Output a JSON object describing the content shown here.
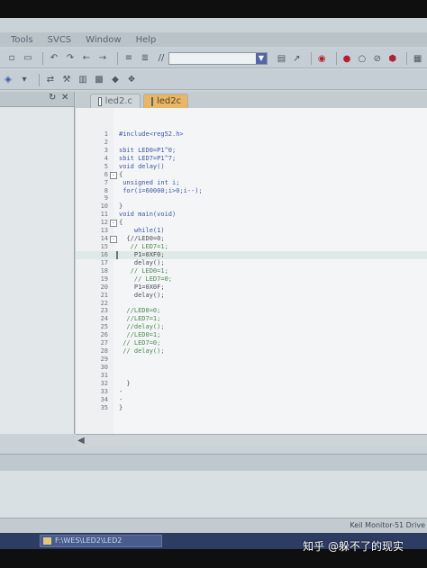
{
  "menu": {
    "items": [
      "Tools",
      "SVCS",
      "Window",
      "Help"
    ]
  },
  "left_pane": {
    "pin_icon": "pin-icon",
    "close_icon": "close-icon"
  },
  "tabs": [
    {
      "label": "led2.c",
      "active": false
    },
    {
      "label": "led2c",
      "active": true
    }
  ],
  "editor": {
    "lines": [
      {
        "n": "1",
        "text": "#include<reg52.h>"
      },
      {
        "n": "2",
        "text": ""
      },
      {
        "n": "3",
        "text": "sbit LED0=P1^0;"
      },
      {
        "n": "4",
        "text": "sbit LED7=P1^7;"
      },
      {
        "n": "5",
        "text": "void delay()"
      },
      {
        "n": "6",
        "text": "{",
        "fold": "-"
      },
      {
        "n": "7",
        "text": " unsigned int i;"
      },
      {
        "n": "8",
        "text": " for(i=60000;i>0;i--);"
      },
      {
        "n": "9",
        "text": ""
      },
      {
        "n": "10",
        "text": "}"
      },
      {
        "n": "11",
        "text": "void main(void)"
      },
      {
        "n": "12",
        "text": "{",
        "fold": "-"
      },
      {
        "n": "13",
        "text": "    while(1)"
      },
      {
        "n": "14",
        "text": "  {//LED0=0;",
        "fold": "-"
      },
      {
        "n": "15",
        "text": "   // LED7=1;"
      },
      {
        "n": "16",
        "text": "    P1=0XF0;",
        "highlight": true
      },
      {
        "n": "17",
        "text": "    delay();"
      },
      {
        "n": "18",
        "text": "   // LED0=1;"
      },
      {
        "n": "19",
        "text": "    // LED7=0;"
      },
      {
        "n": "20",
        "text": "    P1=0X0F;"
      },
      {
        "n": "21",
        "text": "    delay();"
      },
      {
        "n": "22",
        "text": ""
      },
      {
        "n": "23",
        "text": "  //LED0=0;"
      },
      {
        "n": "24",
        "text": "  //LED7=1;"
      },
      {
        "n": "25",
        "text": "  //delay();"
      },
      {
        "n": "26",
        "text": "  //LED0=1;"
      },
      {
        "n": "27",
        "text": " // LED7=0;"
      },
      {
        "n": "28",
        "text": " // delay();"
      },
      {
        "n": "29",
        "text": ""
      },
      {
        "n": "30",
        "text": ""
      },
      {
        "n": "31",
        "text": ""
      },
      {
        "n": "32",
        "text": "  }"
      },
      {
        "n": "33",
        "text": "-"
      },
      {
        "n": "34",
        "text": "-"
      },
      {
        "n": "35",
        "text": "}"
      }
    ]
  },
  "status": {
    "right_text": "Keil Monitor-51 Drive"
  },
  "taskbar": {
    "path": "F:\\WES\\LED2\\LED2"
  },
  "watermark": "知乎 @躲不了的现实"
}
